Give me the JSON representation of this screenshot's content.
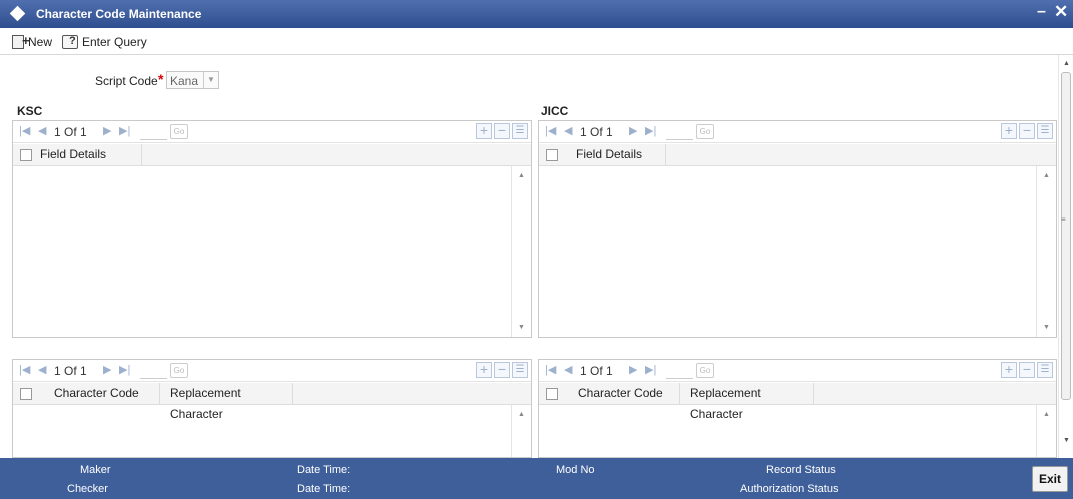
{
  "window": {
    "title": "Character Code Maintenance",
    "minimize": "–",
    "close": "✕"
  },
  "toolbar": {
    "new_label": "New",
    "query_label": "Enter Query"
  },
  "form": {
    "script_code_label": "Script Code",
    "required": "*",
    "script_code_value": "Kana"
  },
  "sections": {
    "left": "KSC",
    "right": "JICC"
  },
  "nav": {
    "page": "1 Of 1",
    "go": "Go",
    "add": "+",
    "delete": "−",
    "view": "☰"
  },
  "grid_top": {
    "col1": "Field Details"
  },
  "grid_bottom": {
    "col1": "Character Code",
    "col2": "Replacement Character"
  },
  "footer": {
    "maker": "Maker",
    "checker": "Checker",
    "date_time_1": "Date Time:",
    "date_time_2": "Date Time:",
    "mod_no": "Mod No",
    "record_status": "Record Status",
    "authorization_status": "Authorization Status",
    "exit": "Exit"
  }
}
